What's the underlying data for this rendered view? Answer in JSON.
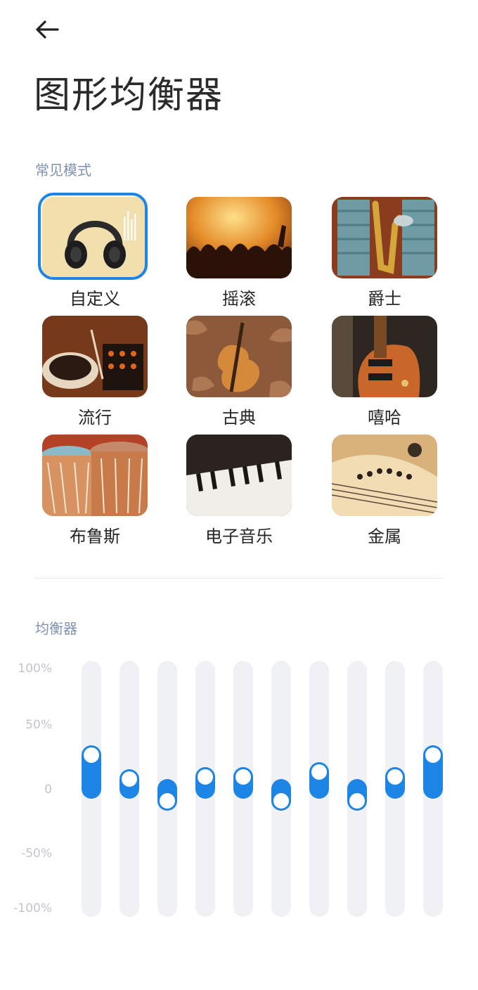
{
  "header": {
    "title": "图形均衡器",
    "back_icon": "arrow-left-icon"
  },
  "presets_section": {
    "label": "常见模式",
    "selected_index": 0,
    "items": [
      {
        "label": "自定义",
        "icon": "headphones-image"
      },
      {
        "label": "摇滚",
        "icon": "rock-concert-image"
      },
      {
        "label": "爵士",
        "icon": "saxophone-image"
      },
      {
        "label": "流行",
        "icon": "turntable-image"
      },
      {
        "label": "古典",
        "icon": "violin-image"
      },
      {
        "label": "嘻哈",
        "icon": "electric-guitar-image"
      },
      {
        "label": "布鲁斯",
        "icon": "drums-image"
      },
      {
        "label": "电子音乐",
        "icon": "keyboard-image"
      },
      {
        "label": "金属",
        "icon": "guitar-strings-image"
      }
    ]
  },
  "equalizer": {
    "label": "均衡器",
    "y_labels": [
      "100%",
      "50%",
      "0",
      "-50%",
      "-100%"
    ],
    "band_levels_percent": [
      28,
      8,
      -10,
      10,
      10,
      -10,
      14,
      -10,
      10,
      28
    ],
    "accent_color": "#1c85e6",
    "track_color": "#eff1f4"
  }
}
